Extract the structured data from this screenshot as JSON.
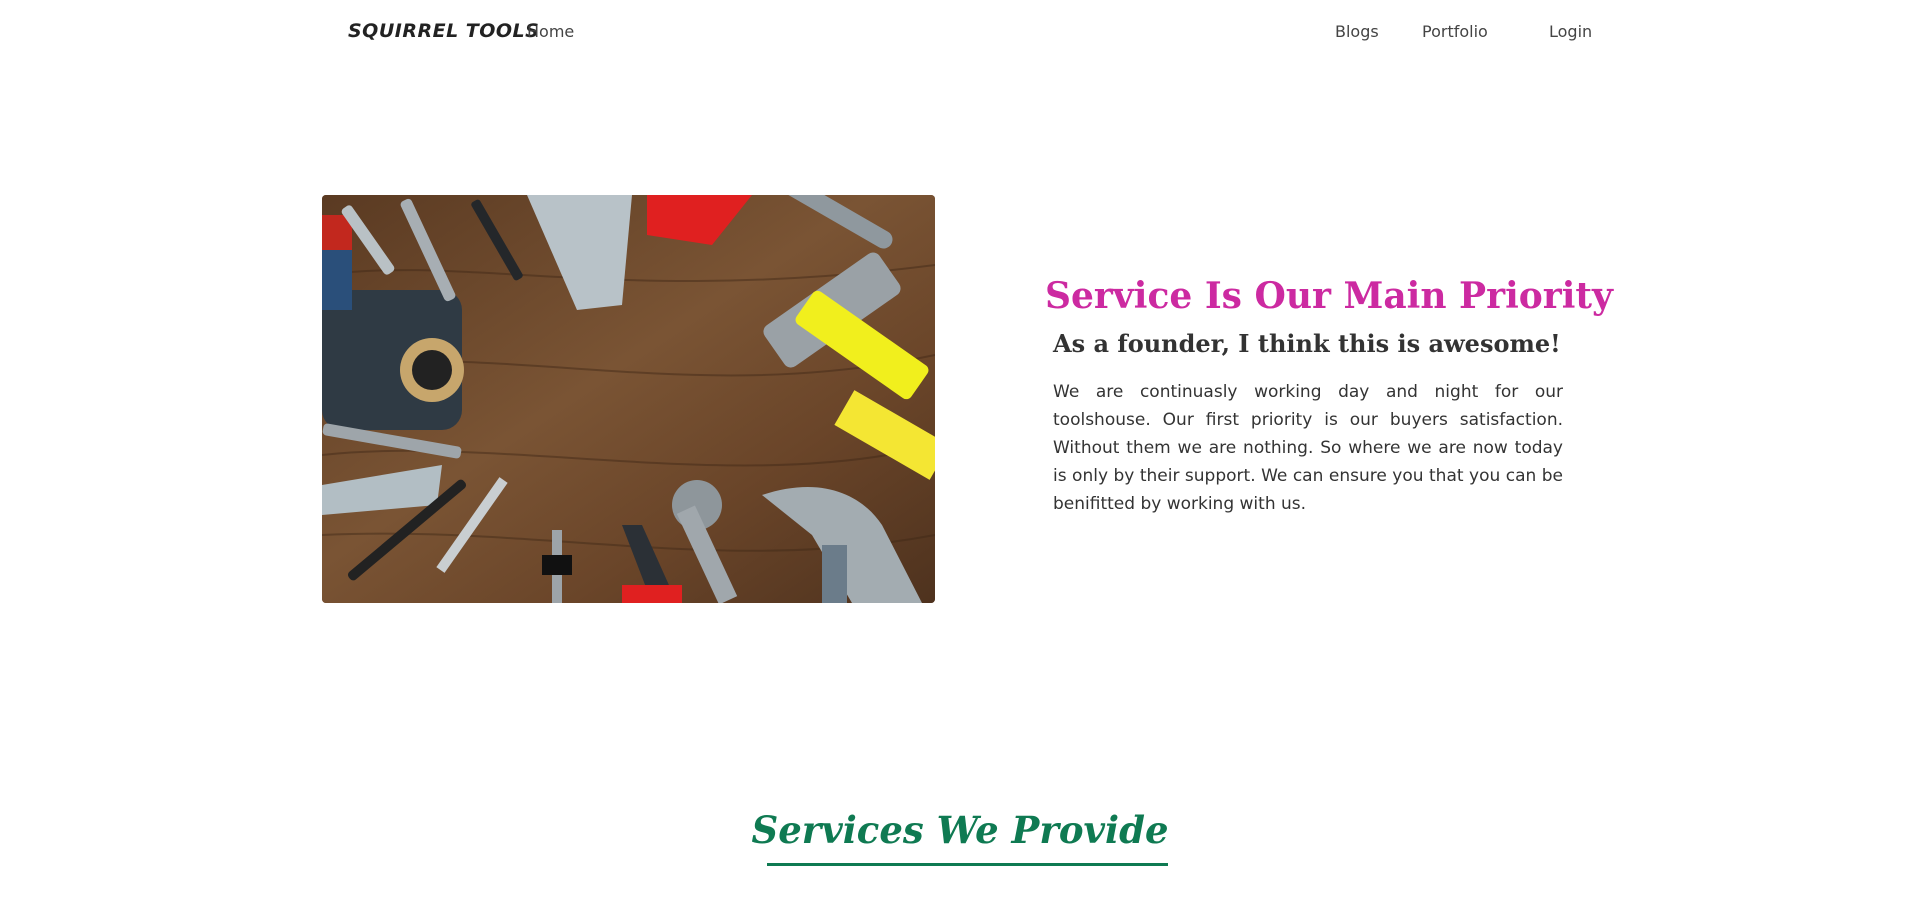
{
  "nav": {
    "brand": "SQUIRREL TOOLS",
    "home": "Home",
    "blogs": "Blogs",
    "portfolio": "Portfolio",
    "login": "Login"
  },
  "hero": {
    "title": "Service Is Our Main Priority",
    "subtitle": "As a founder, I think this is awesome!",
    "body": "We are continuasly working day and night for our toolshouse. Our first priority is our buyers satisfaction. Without them we are nothing. So where we are now today is only by their support. We can ensure you that you can be benifitted by working with us.",
    "image_icon": "tools-photo"
  },
  "services": {
    "title": "Services We Provide"
  },
  "colors": {
    "accent_pink": "#cc2aa1",
    "accent_green": "#0f7a52",
    "text_dark": "#333333"
  }
}
